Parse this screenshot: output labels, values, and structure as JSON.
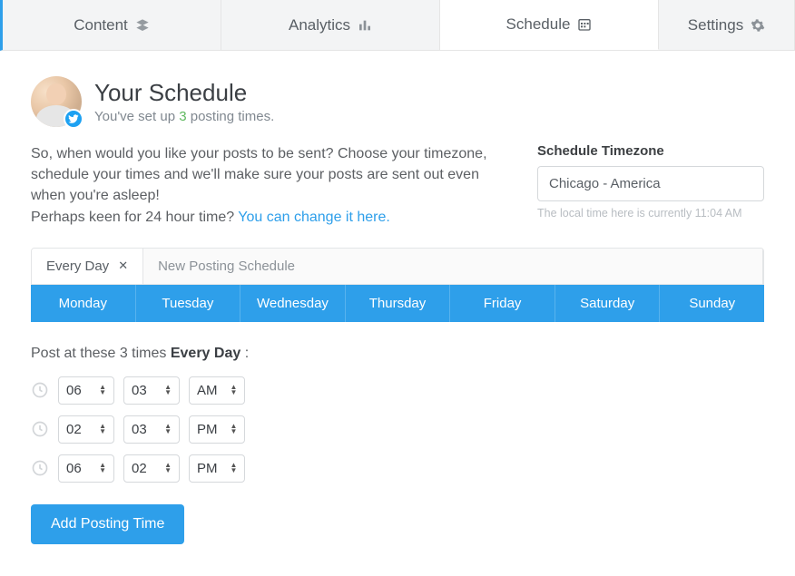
{
  "nav": {
    "tabs": [
      {
        "label": "Content",
        "icon": "layers-icon"
      },
      {
        "label": "Analytics",
        "icon": "bars-icon"
      },
      {
        "label": "Schedule",
        "icon": "calendar-icon"
      },
      {
        "label": "Settings",
        "icon": "gear-icon"
      }
    ],
    "active_index": 2
  },
  "header": {
    "title": "Your Schedule",
    "subtitle_prefix": "You've set up ",
    "posting_count": "3",
    "subtitle_suffix": " posting times.",
    "social_badge": "twitter"
  },
  "intro": {
    "body": "So, when would you like your posts to be sent? Choose your timezone, schedule your times and we'll make sure your posts are sent out even when you're asleep!",
    "hint_prefix": "Perhaps keen for 24 hour time? ",
    "hint_link": "You can change it here."
  },
  "timezone": {
    "label": "Schedule Timezone",
    "value": "Chicago - America",
    "note": "The local time here is currently 11:04 AM"
  },
  "schedule_tabs": {
    "current": "Every Day",
    "new_label": "New Posting Schedule"
  },
  "days": [
    "Monday",
    "Tuesday",
    "Wednesday",
    "Thursday",
    "Friday",
    "Saturday",
    "Sunday"
  ],
  "post_label": {
    "prefix": "Post at these 3 times ",
    "bold": "Every Day",
    "suffix": " :"
  },
  "times": [
    {
      "hour": "06",
      "minute": "03",
      "ampm": "AM"
    },
    {
      "hour": "02",
      "minute": "03",
      "ampm": "PM"
    },
    {
      "hour": "06",
      "minute": "02",
      "ampm": "PM"
    }
  ],
  "actions": {
    "add_time": "Add Posting Time"
  }
}
